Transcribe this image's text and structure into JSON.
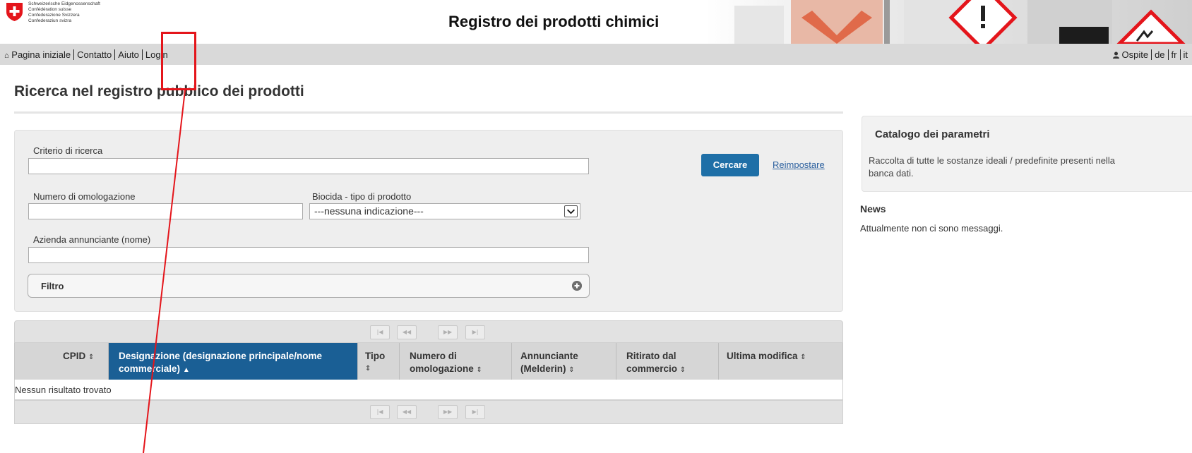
{
  "header": {
    "confederation": [
      "Schweizerische Eidgenossenschaft",
      "Confédération suisse",
      "Confederazione Svizzera",
      "Confederaziun svizra"
    ],
    "app_title": "Registro dei prodotti chimici"
  },
  "nav": {
    "home_icon": "home-icon",
    "items": [
      "Pagina iniziale",
      "Contatto",
      "Aiuto",
      "Login"
    ],
    "user_icon": "user-icon",
    "user": "Ospite",
    "languages": [
      "de",
      "fr",
      "it"
    ]
  },
  "page_title": "Ricerca nel registro pubblico dei prodotti",
  "search": {
    "criteria_label": "Criterio di ricerca",
    "criteria_value": "",
    "approval_label": "Numero di omologazione",
    "approval_value": "",
    "biocide_label": "Biocida - tipo di prodotto",
    "biocide_selected": "---nessuna indicazione---",
    "company_label": "Azienda annunciante (nome)",
    "company_value": "",
    "search_button": "Cercare",
    "reset_link": "Reimpostare",
    "filter_label": "Filtro"
  },
  "table": {
    "columns": [
      {
        "line1": "CPID",
        "line2": "",
        "sort": "⇕"
      },
      {
        "line1": "Designazione (designazione principale/nome",
        "line2": "commerciale)",
        "sort": "▲"
      },
      {
        "line1": "Tipo",
        "line2": "",
        "sort": "⇕"
      },
      {
        "line1": "Numero di",
        "line2": "omologazione",
        "sort": "⇕"
      },
      {
        "line1": "Annunciante",
        "line2": "(Melderin)",
        "sort": "⇕"
      },
      {
        "line1": "Ritirato dal",
        "line2": "commercio",
        "sort": "⇕"
      },
      {
        "line1": "Ultima modifica",
        "line2": "",
        "sort": "⇕"
      }
    ],
    "pager_buttons": [
      "|◀",
      "◀◀",
      "▶▶",
      "▶|"
    ],
    "empty_message": "Nessun risultato trovato"
  },
  "sidebar": {
    "catalog_title": "Catalogo dei parametri",
    "catalog_text": "Raccolta di tutte le sostanze ideali / predefinite presenti nella banca dati.",
    "news_title": "News",
    "news_text": "Attualmente non ci sono messaggi."
  },
  "colors": {
    "primary_blue": "#1e6fa7",
    "header_active": "#1a5f95",
    "annotation_red": "#e4151b"
  }
}
